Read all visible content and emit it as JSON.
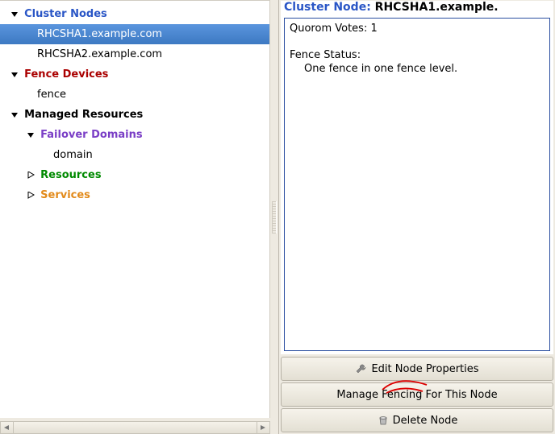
{
  "tree": {
    "cluster_nodes": {
      "label": "Cluster Nodes",
      "items": [
        "RHCSHA1.example.com",
        "RHCSHA2.example.com"
      ]
    },
    "fence_devices": {
      "label": "Fence Devices",
      "items": [
        "fence"
      ]
    },
    "managed_resources": {
      "label": "Managed Resources",
      "failover_domains": {
        "label": "Failover Domains",
        "items": [
          "domain"
        ]
      },
      "resources": {
        "label": "Resources"
      },
      "services": {
        "label": "Services"
      }
    }
  },
  "details": {
    "header_label": "Cluster Node: ",
    "header_value": "RHCSHA1.example.",
    "quorum_line": "Quorom Votes: 1",
    "fence_status_label": "Fence Status:",
    "fence_status_value": "One fence in one fence level."
  },
  "buttons": {
    "edit": "Edit Node Properties",
    "fencing": "Manage Fencing For This Node",
    "delete": "Delete Node"
  }
}
